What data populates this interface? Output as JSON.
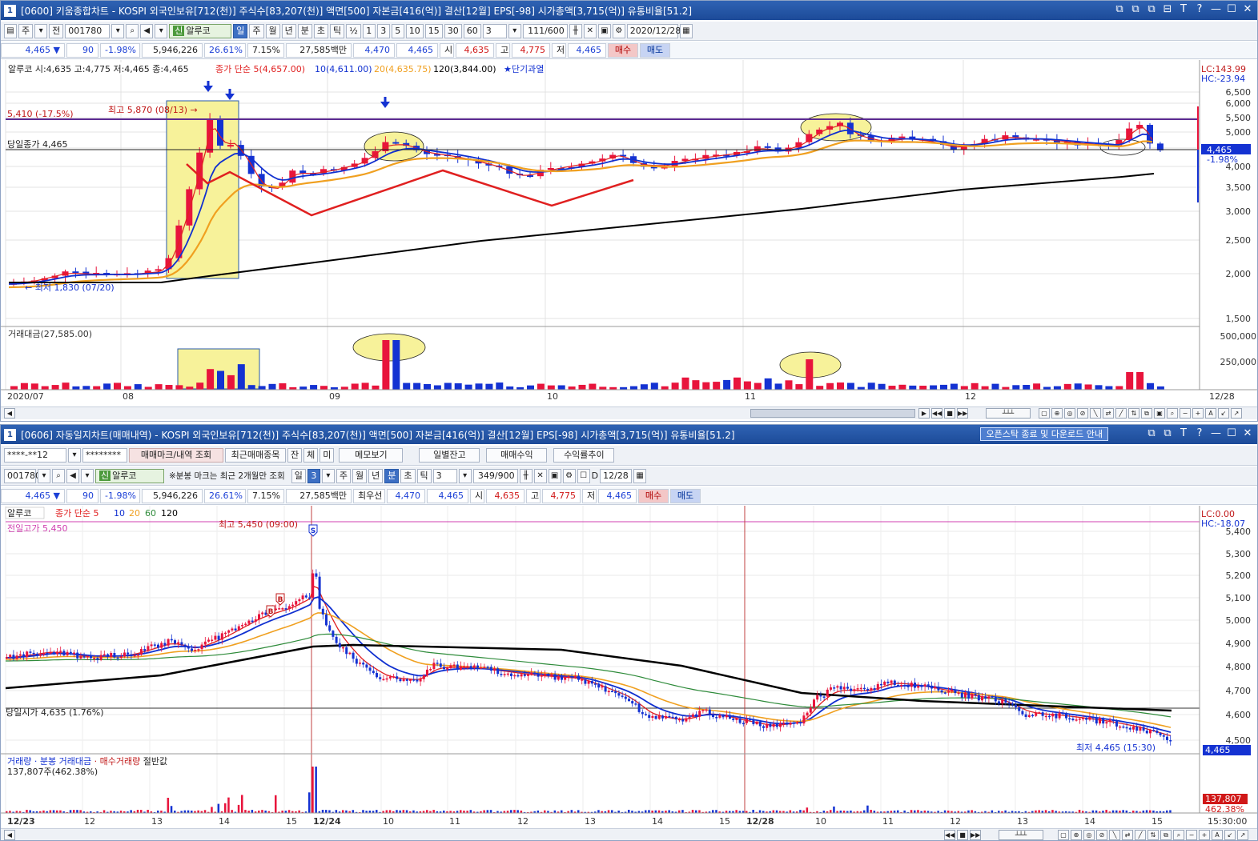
{
  "win1": {
    "badge": "1",
    "title": "[0600] 키움종합차트 - KOSPI 외국인보유[712(천)] 주식수[83,207(천)] 액면[500] 자본금[416(억)] 결산[12월] EPS[-98] 시가총액[3,715(억)] 유통비율[51.2]",
    "window_controls": [
      "⧉",
      "⧉",
      "⧉",
      "⊟",
      "T",
      "?",
      "—",
      "☐",
      "✕"
    ],
    "toolbar": {
      "period_sel": "주",
      "range_sel": "전",
      "code": "001780",
      "stock_tag": "신",
      "stock_name": "알루코",
      "periods": [
        "일",
        "주",
        "월",
        "년",
        "분",
        "초",
        "틱"
      ],
      "active_period": "일",
      "half": "½",
      "minutes": [
        "1",
        "3",
        "5",
        "10",
        "15",
        "30",
        "60"
      ],
      "count": "3",
      "ratio": "111/600",
      "date": "2020/12/28"
    },
    "quote": {
      "price": "4,465 ▼",
      "change": "90",
      "pct": "-1.98%",
      "volume": "5,946,226",
      "vol_ratio": "26.61%",
      "turnover": "7.15%",
      "amount": "27,585백만",
      "best_ask": "4,470",
      "best_bid": "4,465",
      "open_lbl": "시",
      "open": "4,635",
      "high_lbl": "고",
      "high": "4,775",
      "low_lbl": "저",
      "low": "4,465",
      "buy": "매수",
      "sell": "매도"
    },
    "legend": {
      "ohlc": "알루코 시:4,635 고:4,775 저:4,465 종:4,465",
      "ma_title": "종가 단순",
      "ma5": "5(4,657.00)",
      "ma10": "10(4,611.00)",
      "ma20": "20(4,635.75)",
      "ma120": "120(3,844.00)",
      "signal": "★단기과열"
    },
    "annotations": {
      "max": "최고 5,870 (08/13) →",
      "min": "← 최저 1,830 (07/20)",
      "today_close": "당일종가 4,465",
      "resistance": "5,410 (-17.5%)"
    },
    "right_info": {
      "lc": "LC:143.99",
      "hc": "HC:-23.94",
      "price_tag": "4,465",
      "pct_tag": "-1.98%"
    },
    "y_ticks": [
      "6,500",
      "6,000",
      "5,500",
      "5,000",
      "4,500",
      "4,000",
      "3,500",
      "3,000",
      "2,500",
      "2,000",
      "1,500"
    ],
    "vol_legend": "거래대금(27,585.00)",
    "vol_ticks": [
      "500,000",
      "250,000"
    ],
    "x_labels": [
      "2020/07",
      "08",
      "09",
      "10",
      "11",
      "12",
      "12/28"
    ]
  },
  "win2": {
    "badge": "1",
    "title": "[0606] 자동일지차트(매매내역) - KOSPI 외국인보유[712(천)] 주식수[83,207(천)] 액면[500] 자본금[416(억)] 결산[12월] EPS[-98] 시가총액[3,715(억)] 유통비율[51.2]",
    "notice": "오픈스탁 종료 및 다운로드 안내",
    "window_controls": [
      "⧉",
      "⧉",
      "T",
      "?",
      "—",
      "☐",
      "✕"
    ],
    "toolbar1": {
      "account": "****-**12",
      "password": "********",
      "btn_marks": "매매마크/내역 조회",
      "btn_recent": "최근매매종목",
      "btn_bal": "잔",
      "btn_exec": "체",
      "btn_unexec": "미",
      "btn_memo": "메모보기",
      "btn_daily": "일별잔고",
      "btn_profit": "매매수익",
      "btn_trend": "수익률추이"
    },
    "toolbar2": {
      "code": "001780",
      "stock_tag": "신",
      "stock_name": "알루코",
      "note": "※분봉 마크는 최근 2개월만 조회",
      "periods": [
        "일",
        "주",
        "월",
        "년",
        "분",
        "초",
        "틱"
      ],
      "active_period": "분",
      "day_count": "3",
      "min_count": "3",
      "ratio": "349/900",
      "check_label": "D",
      "date": "12/28"
    },
    "quote": {
      "price": "4,465 ▼",
      "change": "90",
      "pct": "-1.98%",
      "volume": "5,946,226",
      "vol_ratio": "26.61%",
      "turnover": "7.15%",
      "amount": "27,585백만",
      "best_lbl": "최우선",
      "best_ask": "4,470",
      "best_bid": "4,465",
      "open_lbl": "시",
      "open": "4,635",
      "high_lbl": "고",
      "high": "4,775",
      "low_lbl": "저",
      "low": "4,465",
      "buy": "매수",
      "sell": "매도"
    },
    "legend": {
      "name": "알루코",
      "ma_title": "종가 단순",
      "ma5": "5",
      "ma10": "10",
      "ma20": "20",
      "ma60": "60",
      "ma120": "120"
    },
    "annotations": {
      "max": "최고 5,450 (09:00)",
      "prev_high": "전일고가 5,450",
      "today_open": "당일시가 4,635 (1.76%)",
      "min": "최저 4,465 (15:30)"
    },
    "right_info": {
      "lc": "LC:0.00",
      "hc": "HC:-18.07",
      "price_tag": "4,465",
      "vol_tag": "137,807",
      "vol_pct": "462.38%"
    },
    "y_ticks": [
      "5,400",
      "5,300",
      "5,200",
      "5,100",
      "5,000",
      "4,900",
      "4,800",
      "4,700",
      "4,600",
      "4,500"
    ],
    "vol_legend": {
      "vol": "거래량",
      "min_amt": "분봉 거래대금",
      "buy_vol": "매수거래량",
      "half": "절반값"
    },
    "vol_value": "137,807주(462.38%)",
    "x_labels": [
      "12/23",
      "12",
      "13",
      "14",
      "15",
      "12/24",
      "10",
      "11",
      "12",
      "13",
      "14",
      "15",
      "12/28",
      "10",
      "11",
      "12",
      "13",
      "14",
      "15",
      "15:30:00"
    ]
  },
  "colors": {
    "up": "#e8143c",
    "down": "#1432d2",
    "ma5": "#e02020",
    "ma10": "#1030d0",
    "ma20": "#f0a020",
    "ma60": "#2e8b3a",
    "ma120": "#000000",
    "highlight": "#f7f29a",
    "titlebar": "#1c4a98"
  }
}
